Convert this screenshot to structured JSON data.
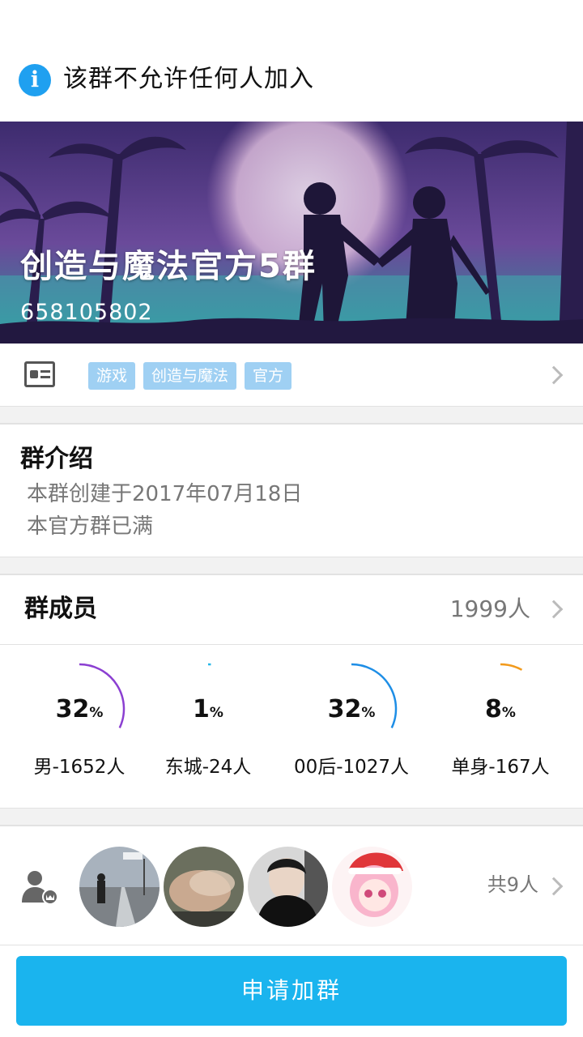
{
  "notice": {
    "icon": "info-icon",
    "text": "该群不允许任何人加入"
  },
  "banner": {
    "title": "创造与魔法官方5群",
    "group_id": "658105802"
  },
  "tags": [
    "游戏",
    "创造与魔法",
    "官方"
  ],
  "intro": {
    "heading": "群介绍",
    "line1": "本群创建于2017年07月18日",
    "line2": "本官方群已满"
  },
  "members": {
    "heading": "群成员",
    "count": "1999人",
    "stats": [
      {
        "value": 32,
        "unit": "%",
        "label": "男-1652人",
        "color": "#8b3fd1"
      },
      {
        "value": 1,
        "unit": "%",
        "label": "东城-24人",
        "color": "#25b7e8"
      },
      {
        "value": 32,
        "unit": "%",
        "label": "00后-1027人",
        "color": "#1e8ee6"
      },
      {
        "value": 8,
        "unit": "%",
        "label": "单身-167人",
        "color": "#f29a1c"
      }
    ]
  },
  "avatars": {
    "total": "共9人"
  },
  "join_button": "申请加群"
}
